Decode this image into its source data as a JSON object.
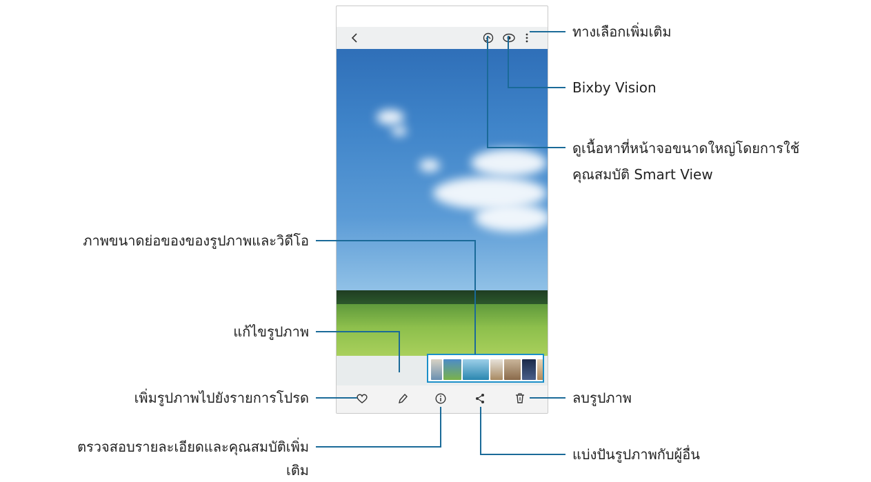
{
  "labels": {
    "more_options": "ทางเลือกเพิ่มเติม",
    "bixby_vision": "Bixby Vision",
    "smart_view_line1": "ดูเนื้อหาที่หน้าจอขนาดใหญ่โดยการใช้",
    "smart_view_line2": "คุณสมบัติ Smart View",
    "thumbnails": "ภาพขนาดย่อของของรูปภาพและวิดีโอ",
    "edit": "แก้ไขรูปภาพ",
    "favorite": "เพิ่มรูปภาพไปยังรายการโปรด",
    "details_line1": "ตรวจสอบรายละเอียดและคุณสมบัติเพิ่ม",
    "details_line2": "เติม",
    "delete": "ลบรูปภาพ",
    "share": "แบ่งปันรูปภาพกับผู้อื่น"
  },
  "icons": {
    "back": "back-icon",
    "smart_view": "smart-view-icon",
    "bixby": "eye-icon",
    "more": "more-vertical-icon",
    "favorite": "heart-icon",
    "edit": "pencil-icon",
    "details": "info-icon",
    "share": "share-icon",
    "delete": "trash-icon"
  },
  "colors": {
    "leader_line": "#1a6a98",
    "thumbnail_border": "#1a8fc8"
  }
}
